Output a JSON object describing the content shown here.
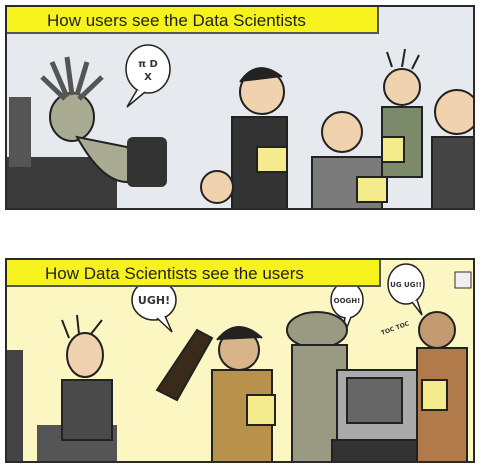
{
  "panels": [
    {
      "caption": "How users see the Data Scientists",
      "speech": [
        "π D",
        "X"
      ]
    },
    {
      "caption": "How Data Scientists see the users",
      "speech": [
        "UGH!",
        "OOGH!",
        "UG UG!!",
        "TOC TOC"
      ]
    }
  ],
  "colors": {
    "caption_bg": "#f6f21e",
    "panel1_bg": "#e6eaee",
    "panel2_bg": "#fbf6c2"
  }
}
